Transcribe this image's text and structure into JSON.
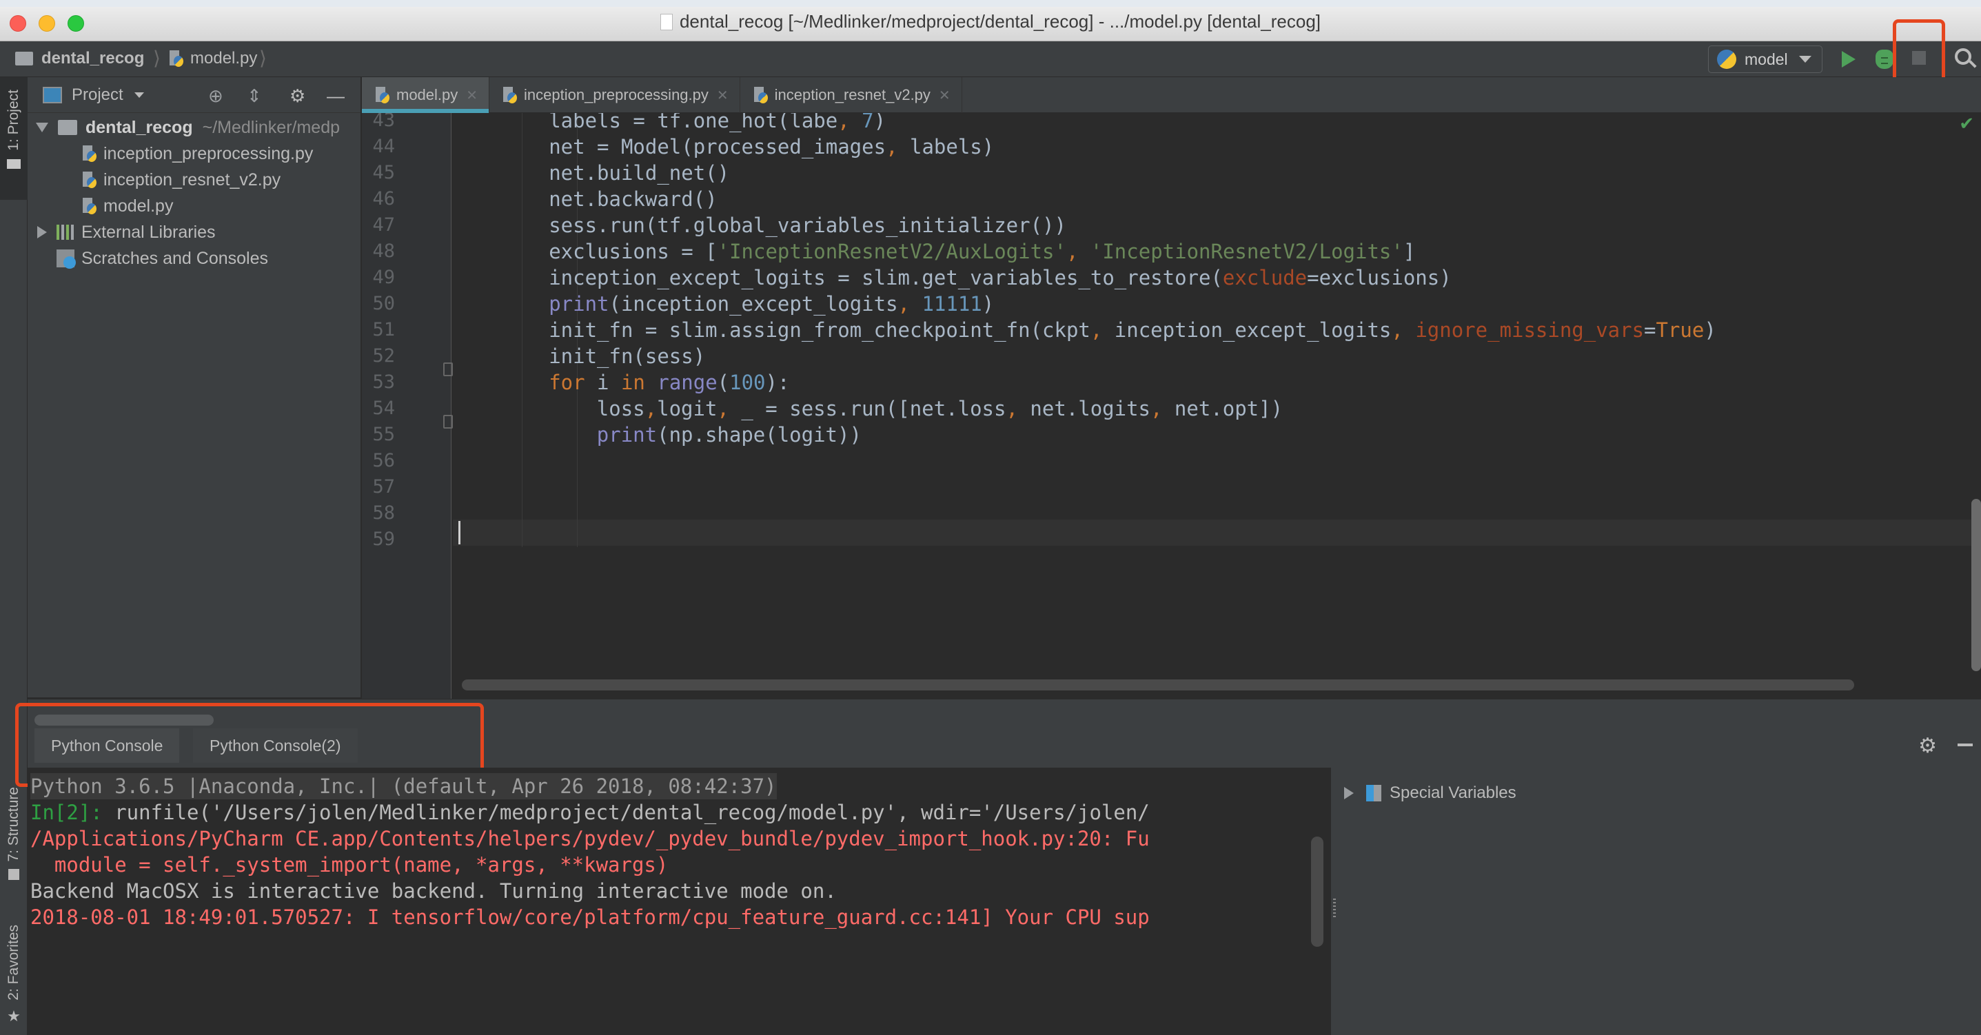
{
  "window": {
    "title": "dental_recog [~/Medlinker/medproject/dental_recog] - .../model.py [dental_recog]"
  },
  "navbar": {
    "breadcrumbs": [
      "dental_recog",
      "model.py"
    ],
    "run_config": "model",
    "actions": [
      "run",
      "debug",
      "stop",
      "search"
    ]
  },
  "left_stripe": {
    "project": "1: Project",
    "structure": "7: Structure",
    "favorites": "2: Favorites"
  },
  "project_panel": {
    "title": "Project",
    "root": {
      "name": "dental_recog",
      "path": "~/Medlinker/medp"
    },
    "files": [
      "inception_preprocessing.py",
      "inception_resnet_v2.py",
      "model.py"
    ],
    "external": "External Libraries",
    "scratches": "Scratches and Consoles"
  },
  "editor": {
    "tabs": [
      {
        "label": "model.py",
        "active": true
      },
      {
        "label": "inception_preprocessing.py",
        "active": false
      },
      {
        "label": "inception_resnet_v2.py",
        "active": false
      }
    ],
    "line_numbers": [
      "43",
      "44",
      "45",
      "46",
      "47",
      "48",
      "49",
      "50",
      "51",
      "52",
      "53",
      "54",
      "55",
      "56",
      "57",
      "58",
      "59"
    ],
    "current_line": "59",
    "status": "no-problems",
    "lines": [
      "labels = tf.one_hot(labe, 7)",
      "net = Model(processed_images, labels)",
      "net.build_net()",
      "net.backward()",
      "sess.run(tf.global_variables_initializer())",
      "exclusions = ['InceptionResnetV2/AuxLogits', 'InceptionResnetV2/Logits']",
      "inception_except_logits = slim.get_variables_to_restore(exclude=exclusions)",
      "print(inception_except_logits, 11111)",
      "init_fn = slim.assign_from_checkpoint_fn(ckpt, inception_except_logits, ignore_missing_vars=True)",
      "init_fn(sess)",
      "for i in range(100):",
      "loss,logit, _ = sess.run([net.loss, net.logits, net.opt])",
      "print(np.shape(logit))",
      "",
      "",
      "",
      ""
    ]
  },
  "console": {
    "tabs": [
      "Python Console",
      "Python Console(2)"
    ],
    "lines": [
      {
        "kind": "banner",
        "text": "Python 3.6.5 |Anaconda, Inc.| (default, Apr 26 2018, 08:42:37)"
      },
      {
        "kind": "input",
        "prompt": "In[2]:",
        "text": " runfile('/Users/jolen/Medlinker/medproject/dental_recog/model.py', wdir='/Users/jolen/"
      },
      {
        "kind": "err",
        "text": "/Applications/PyCharm CE.app/Contents/helpers/pydev/_pydev_bundle/pydev_import_hook.py:20: Fu"
      },
      {
        "kind": "err",
        "text": "  module = self._system_import(name, *args, **kwargs)"
      },
      {
        "kind": "out",
        "text": "Backend MacOSX is interactive backend. Turning interactive mode on."
      },
      {
        "kind": "err",
        "text": "2018-08-01 18:49:01.570527: I tensorflow/core/platform/cpu_feature_guard.cc:141] Your CPU sup"
      }
    ]
  },
  "variables": {
    "items": [
      "Special Variables"
    ]
  },
  "colors": {
    "highlight_box": "#e5461f",
    "run_green": "#4fa15a",
    "active_tab_underline": "#4a9fb5",
    "error_text": "#ff6b68",
    "keyword": "#cc7832",
    "string": "#6a8759",
    "number": "#6897bb"
  }
}
